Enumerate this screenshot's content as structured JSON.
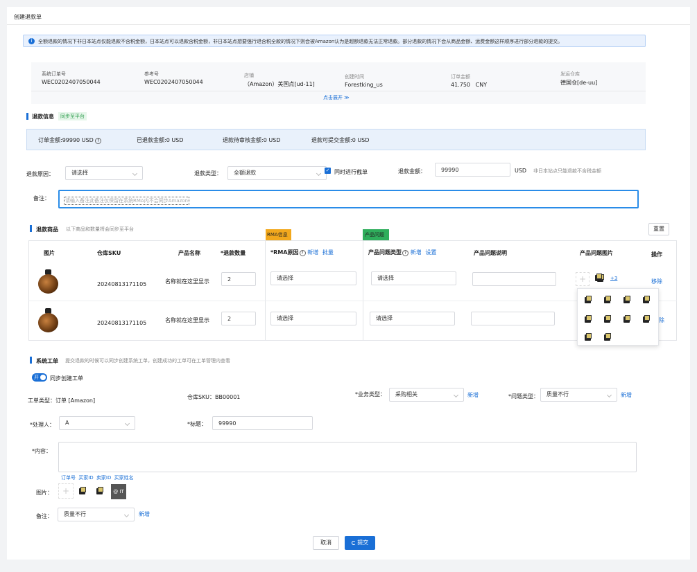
{
  "page_title": "创建退款单",
  "notice": "全额退款的情况下非日本站点仅能退款不含税金额，日本站点可以退款含税金额，非日本站点想要强行退含税全款的情况下则会被Amazon认为是超额退款无法正常退款。部分退款的情况下会从商品金额、运费金额这样顺序进行部分退款的提交。",
  "order": {
    "sys_label": "系统订单号",
    "sys_value": "WEC0202407050044",
    "ref_label": "参考号",
    "ref_value": "WEC0202407050044",
    "shop_label": "店铺",
    "shop_value": "（Amazon）美国点[ud-11]",
    "created_label": "创建时间",
    "created_value": "Forestking_us",
    "amount_label": "订单金额",
    "amount_value": "41.750",
    "amount_currency": "CNY",
    "warehouse_label": "发运仓库",
    "warehouse_value": "德国仓[de-uu]",
    "expand": "点击展开 ≫"
  },
  "refund_info": {
    "title": "退款信息",
    "tag": "同步至平台",
    "order_amount": "订单金额:99990 USD",
    "refunded": "已退款金额:0 USD",
    "pending": "退款待审核金额:0 USD",
    "available": "退款可提交金额:0 USD"
  },
  "form": {
    "reason_label": "退款原因：",
    "reason_value": "请选择",
    "type_label": "退款类型：",
    "type_value": "全额退款",
    "intercept_label": "同时进行截单",
    "amount_label": "退款金额：",
    "amount_value": "99990",
    "amount_unit": "USD",
    "amount_hint": "非日本站点只能退款不含税金额",
    "remark_label": "备注：",
    "remark_placeholder": "请输入备注此备注仅保留在系统RMA内不会同步Amazon"
  },
  "goods": {
    "title": "退款商品",
    "hint": "以下商品和数量将会同步至平台",
    "reset": "重置",
    "rma_tag": "RMA信息",
    "problem_tag": "产品问题",
    "headers": {
      "image": "图片",
      "sku": "仓库SKU",
      "name": "产品名称",
      "qty": "*退款数量",
      "rma": "*RMA原因",
      "add": "新增",
      "batch": "批量",
      "ptype": "产品问题类型",
      "setting": "设置",
      "pdesc": "产品问题说明",
      "pimg": "产品问题图片",
      "op": "操作"
    },
    "rows": [
      {
        "sku": "20240813171105",
        "name": "名称就在这里显示",
        "qty": "2",
        "rma": "请选择",
        "ptype": "请选择",
        "more": "+3",
        "remove": "移除"
      },
      {
        "sku": "20240813171105",
        "name": "名称就在这里显示",
        "qty": "2",
        "rma": "请选择",
        "ptype": "请选择",
        "remove": "除"
      }
    ]
  },
  "ticket": {
    "title": "系统工单",
    "hint": "提交退款的时候可以同步创建系统工单，创建成功的工单可在工单管理内查看",
    "toggle_on": "开",
    "toggle_label": "同步创建工单",
    "type_label": "工单类型：订单 [Amazon]",
    "sku_label": "仓库SKU：BB00001",
    "biz_label": "*业务类型：",
    "biz_value": "采购相关",
    "biz_add": "新增",
    "issue_label": "*问题类型：",
    "issue_value": "质量不行",
    "issue_add": "新增",
    "handler_label": "*处理人：",
    "handler_value": "A",
    "subject_label": "*标题：",
    "subject_value": "99990",
    "content_label": "*内容：",
    "vars": [
      "订单号",
      "买家ID",
      "卖家ID",
      "买家姓名"
    ],
    "image_label": "图片：",
    "img_text": "@ IT",
    "remark_label": "备注：",
    "remark_value": "质量不行",
    "remark_add": "新增"
  },
  "actions": {
    "cancel": "取消",
    "submit": "提交"
  }
}
